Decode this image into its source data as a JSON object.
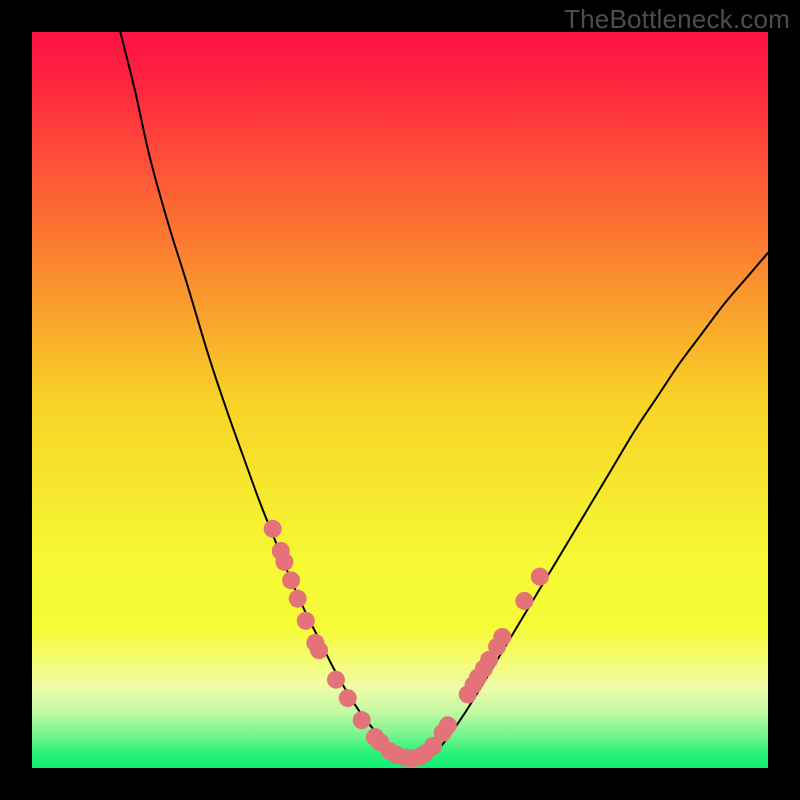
{
  "watermark": "TheBottleneck.com",
  "chart_data": {
    "type": "line",
    "title": "",
    "xlabel": "",
    "ylabel": "",
    "xlim": [
      0,
      100
    ],
    "ylim": [
      0,
      100
    ],
    "grid": false,
    "legend": false,
    "description": "V-shaped bottleneck curve over a vertical red-to-green gradient background",
    "background_gradient_stops": [
      {
        "offset": 0.0,
        "color": "#FE1243"
      },
      {
        "offset": 0.06,
        "color": "#FE213F"
      },
      {
        "offset": 0.3,
        "color": "#FC8130"
      },
      {
        "offset": 0.5,
        "color": "#F7D227"
      },
      {
        "offset": 0.72,
        "color": "#F6F934"
      },
      {
        "offset": 0.81,
        "color": "#F6FB37"
      },
      {
        "offset": 0.85,
        "color": "#F5FC6E"
      },
      {
        "offset": 0.89,
        "color": "#EEFCA7"
      },
      {
        "offset": 0.925,
        "color": "#C1F9A4"
      },
      {
        "offset": 0.955,
        "color": "#76F58E"
      },
      {
        "offset": 0.98,
        "color": "#28F279"
      },
      {
        "offset": 1.0,
        "color": "#10F172"
      }
    ],
    "series": [
      {
        "name": "bottleneck-curve",
        "x": [
          12,
          14,
          16,
          18.5,
          21,
          24,
          26.5,
          29,
          31,
          33,
          35,
          37,
          39,
          41,
          43,
          45,
          48,
          51,
          54,
          56,
          58.5,
          61,
          64,
          67,
          70,
          73,
          76,
          79,
          82,
          85,
          88,
          91,
          94,
          97,
          100
        ],
        "y": [
          100,
          92,
          83,
          74,
          66,
          56,
          48.5,
          41.5,
          36,
          31,
          26,
          21.5,
          17.5,
          13.5,
          10,
          7,
          3.5,
          1.2,
          1.5,
          3.5,
          7,
          11,
          16,
          21,
          26,
          31,
          36,
          41,
          46,
          50.5,
          55,
          59,
          63,
          66.5,
          70
        ]
      }
    ],
    "markers": [
      {
        "x": 32.7,
        "y": 32.5
      },
      {
        "x": 33.8,
        "y": 29.5
      },
      {
        "x": 34.3,
        "y": 28.0
      },
      {
        "x": 35.2,
        "y": 25.5
      },
      {
        "x": 36.1,
        "y": 23.0
      },
      {
        "x": 37.2,
        "y": 20.0
      },
      {
        "x": 38.5,
        "y": 17.0
      },
      {
        "x": 39.0,
        "y": 16.0
      },
      {
        "x": 41.3,
        "y": 12.0
      },
      {
        "x": 42.9,
        "y": 9.5
      },
      {
        "x": 44.8,
        "y": 6.5
      },
      {
        "x": 46.6,
        "y": 4.2
      },
      {
        "x": 47.3,
        "y": 3.5
      },
      {
        "x": 48.6,
        "y": 2.3
      },
      {
        "x": 49.5,
        "y": 1.8
      },
      {
        "x": 50.8,
        "y": 1.4
      },
      {
        "x": 51.7,
        "y": 1.3
      },
      {
        "x": 52.6,
        "y": 1.5
      },
      {
        "x": 53.4,
        "y": 2.0
      },
      {
        "x": 54.5,
        "y": 3.0
      },
      {
        "x": 55.8,
        "y": 4.8
      },
      {
        "x": 56.5,
        "y": 5.8
      },
      {
        "x": 59.2,
        "y": 10.0
      },
      {
        "x": 60.0,
        "y": 11.3
      },
      {
        "x": 60.6,
        "y": 12.3
      },
      {
        "x": 61.4,
        "y": 13.5
      },
      {
        "x": 62.1,
        "y": 14.7
      },
      {
        "x": 63.2,
        "y": 16.5
      },
      {
        "x": 63.9,
        "y": 17.8
      },
      {
        "x": 66.9,
        "y": 22.7
      },
      {
        "x": 69.0,
        "y": 26.0
      }
    ]
  }
}
